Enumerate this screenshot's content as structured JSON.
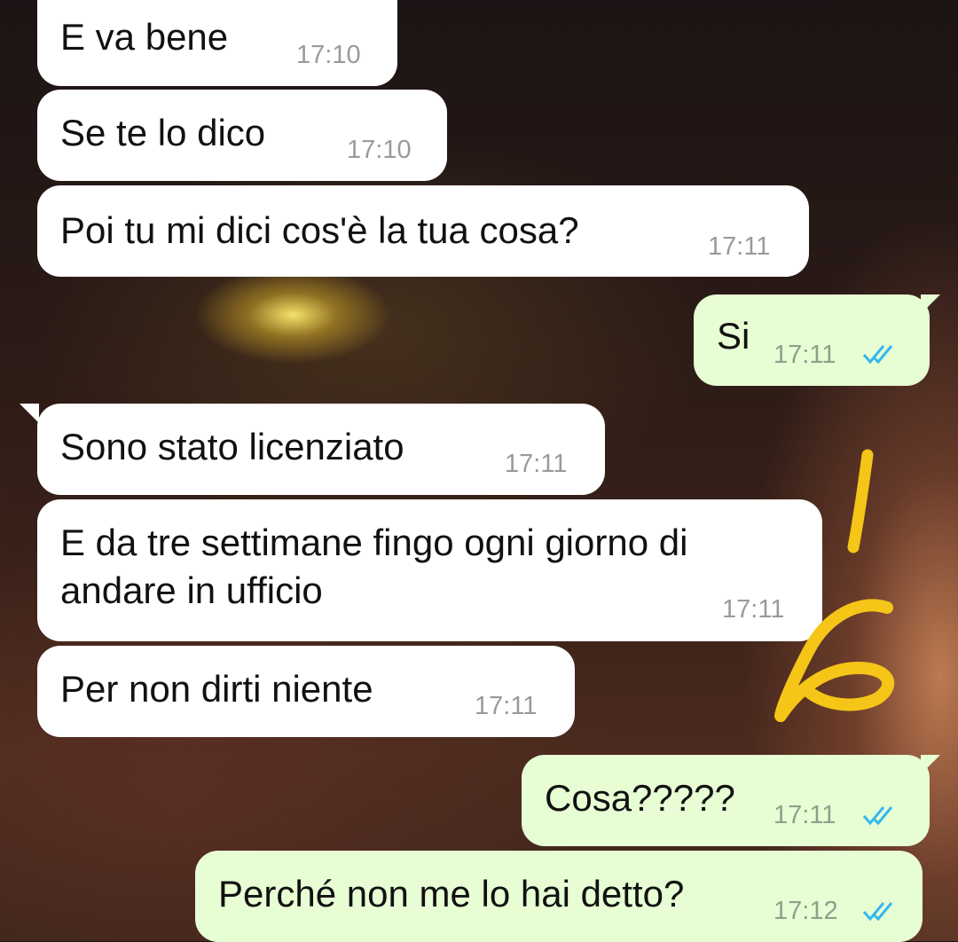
{
  "messages": [
    {
      "text": "E va bene",
      "time": "17:10",
      "direction": "in"
    },
    {
      "text": "Se te lo dico",
      "time": "17:10",
      "direction": "in"
    },
    {
      "text": "Poi tu mi dici cos'è la tua cosa?",
      "time": "17:11",
      "direction": "in"
    },
    {
      "text": "Si",
      "time": "17:11",
      "direction": "out",
      "status": "read"
    },
    {
      "text": "Sono stato licenziato",
      "time": "17:11",
      "direction": "in"
    },
    {
      "text": "E da tre settimane fingo ogni giorno di\nandare in ufficio",
      "time": "17:11",
      "direction": "in"
    },
    {
      "text": "Per non dirti niente",
      "time": "17:11",
      "direction": "in"
    },
    {
      "text": "Cosa?????",
      "time": "17:11",
      "direction": "out",
      "status": "read"
    },
    {
      "text": "Perché non me lo hai detto?",
      "time": "17:12",
      "direction": "out",
      "status": "read"
    }
  ],
  "colors": {
    "incoming_bubble": "#ffffff",
    "outgoing_bubble": "#e7fdd3",
    "read_ticks": "#34b7f1",
    "doodle": "#f5c518",
    "timestamp": "#9a9a9a"
  },
  "icons": {
    "read_status": "double-check-icon"
  }
}
